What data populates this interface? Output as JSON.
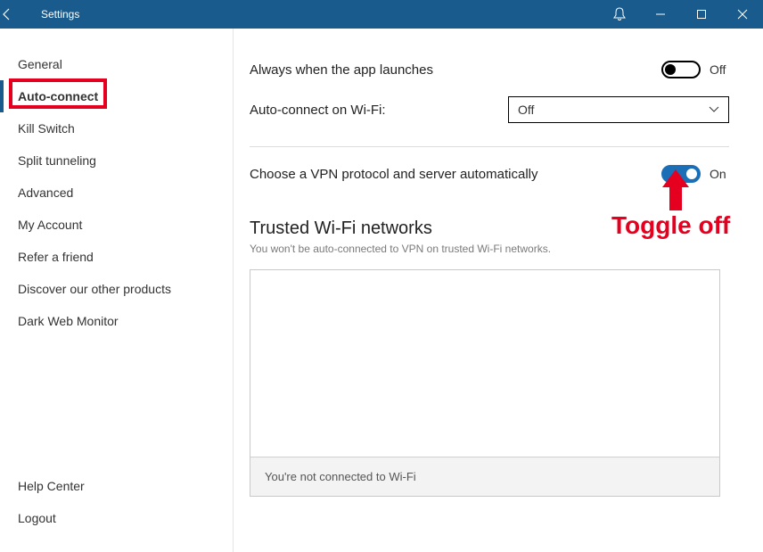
{
  "window": {
    "title": "Settings"
  },
  "sidebar": {
    "items": [
      {
        "label": "General"
      },
      {
        "label": "Auto-connect",
        "selected": true
      },
      {
        "label": "Kill Switch"
      },
      {
        "label": "Split tunneling"
      },
      {
        "label": "Advanced"
      },
      {
        "label": "My Account"
      },
      {
        "label": "Refer a friend"
      },
      {
        "label": "Discover our other products"
      },
      {
        "label": "Dark Web Monitor"
      }
    ],
    "bottom": [
      {
        "label": "Help Center"
      },
      {
        "label": "Logout"
      }
    ]
  },
  "content": {
    "always_launch": {
      "label": "Always when the app launches",
      "state_text": "Off"
    },
    "autoconnect_wifi": {
      "label": "Auto-connect on Wi-Fi:",
      "value": "Off"
    },
    "auto_protocol": {
      "label": "Choose a VPN protocol and server automatically",
      "state_text": "On"
    },
    "trusted": {
      "title": "Trusted Wi-Fi networks",
      "subtitle": "You won't be auto-connected to VPN on trusted Wi-Fi networks.",
      "footer": "You're not connected to Wi-Fi"
    }
  },
  "annotations": {
    "highlight": "Auto-connect",
    "arrow_text": "Toggle off",
    "color": "#e6001f"
  }
}
